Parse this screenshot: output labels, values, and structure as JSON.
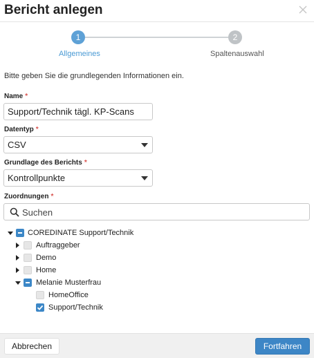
{
  "dialog": {
    "title": "Bericht anlegen",
    "close_icon": "close-icon"
  },
  "stepper": {
    "steps": [
      {
        "number": "1",
        "label": "Allgemeines",
        "active": true
      },
      {
        "number": "2",
        "label": "Spaltenauswahl",
        "active": false
      }
    ],
    "colors": {
      "active": "#5ea1d6",
      "inactive": "#bfc3c6"
    }
  },
  "intro": "Bitte geben Sie die grundlegenden Informationen ein.",
  "form": {
    "name": {
      "label": "Name",
      "required_mark": "*",
      "value": "Support/Technik tägl. KP-Scans"
    },
    "datentyp": {
      "label": "Datentyp",
      "required_mark": "*",
      "value": "CSV"
    },
    "grundlage": {
      "label": "Grundlage des Berichts",
      "required_mark": "*",
      "value": "Kontrollpunkte"
    },
    "zuordnungen": {
      "label": "Zuordnungen",
      "required_mark": "*",
      "search_placeholder": "Suchen"
    }
  },
  "tree": [
    {
      "label": "COREDINATE Support/Technik",
      "expanded": true,
      "state": "partial"
    },
    {
      "label": "Auftraggeber",
      "expanded": false,
      "state": "unchecked"
    },
    {
      "label": "Demo",
      "expanded": false,
      "state": "unchecked"
    },
    {
      "label": "Home",
      "expanded": false,
      "state": "unchecked"
    },
    {
      "label": "Melanie Musterfrau",
      "expanded": true,
      "state": "partial"
    },
    {
      "label": "HomeOffice",
      "state": "unchecked"
    },
    {
      "label": "Support/Technik",
      "state": "checked"
    }
  ],
  "footer": {
    "cancel_label": "Abbrechen",
    "next_label": "Fortfahren"
  },
  "colors": {
    "primary": "#3d86c6",
    "required": "#d9534f",
    "step_active_text": "#4a9ad4"
  }
}
